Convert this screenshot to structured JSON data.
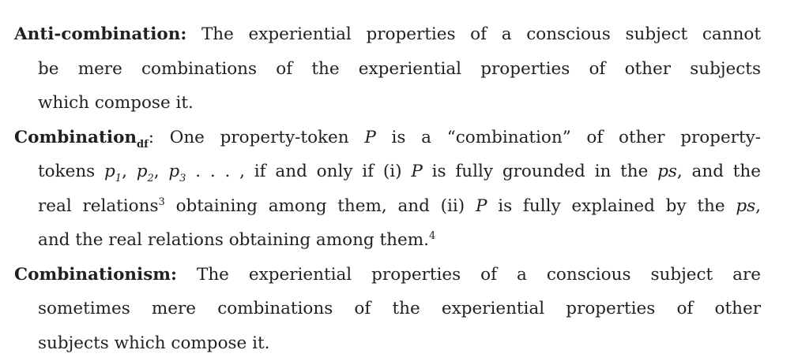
{
  "anti": {
    "term": "Anti-combination:",
    "lines": [
      " The experiential properties of a conscious subject cannot",
      "be mere combinations of the experiential properties of other subjects",
      "which compose it."
    ]
  },
  "comb": {
    "term": "Combination",
    "term_sub": "df",
    "l1": ": One property-token ",
    "P": "P",
    "l1b": " is a “combination” of other property-",
    "l2a": "tokens ",
    "p": "p",
    "s1": "1",
    "s2": "2",
    "s3": "3",
    "comma": ", ",
    "l2b": " . . . , if and only if (i) ",
    "l2c": " is fully grounded in the ",
    "ps": "ps",
    "l2d": ", and the",
    "l3a": "real relations",
    "fn3": "3",
    "l3b": " obtaining among them, and (ii) ",
    "l3c": " is fully explained by the ",
    "l3d": ",",
    "l4": "and the real relations obtaining among them.",
    "fn4": "4"
  },
  "combism": {
    "term": "Combinationism:",
    "lines": [
      " The experiential properties of a conscious subject are",
      "sometimes mere combinations of the experiential properties of other",
      "subjects which compose it."
    ]
  }
}
